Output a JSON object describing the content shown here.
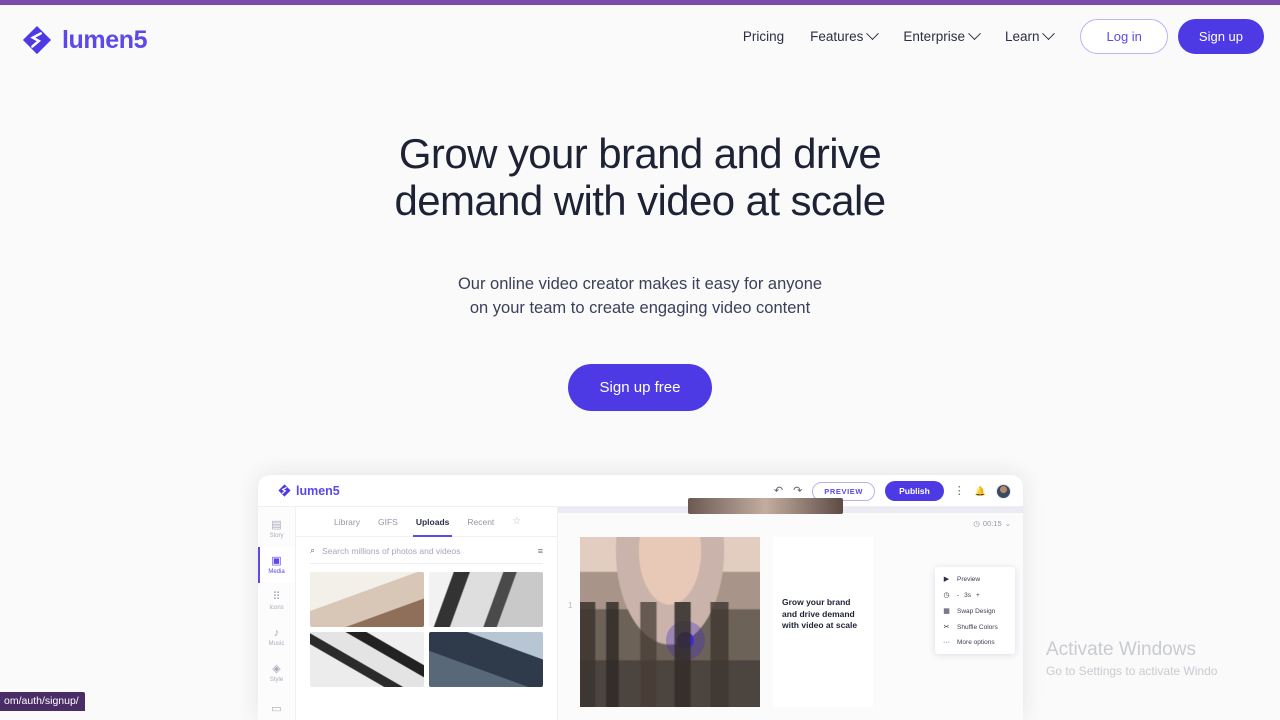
{
  "browser": {
    "top_bar_color": "#7a4bab",
    "status_url": "om/auth/signup/"
  },
  "header": {
    "brand": "lumen5",
    "brand_color": "#5b4ae8",
    "nav": [
      {
        "label": "Pricing",
        "has_chevron": false
      },
      {
        "label": "Features",
        "has_chevron": true
      },
      {
        "label": "Enterprise",
        "has_chevron": true
      },
      {
        "label": "Learn",
        "has_chevron": true
      }
    ],
    "login_label": "Log in",
    "signup_label": "Sign up"
  },
  "hero": {
    "title_line1": "Grow your brand and drive",
    "title_line2": "demand with video at scale",
    "subtitle_line1": "Our online video creator makes it easy for anyone",
    "subtitle_line2": "on your team to create engaging video content",
    "cta_label": "Sign up free",
    "cta_color": "#4e3ae4"
  },
  "mockup": {
    "brand": "lumen5",
    "topbar": {
      "undo_icon": "↶",
      "redo_icon": "↷",
      "preview_label": "PREVIEW",
      "publish_label": "Publish",
      "kebab_icon": "⋮",
      "bell_icon": "🔔"
    },
    "sidebar": [
      {
        "label": "Story",
        "glyph": "▤",
        "active": false
      },
      {
        "label": "Media",
        "glyph": "▣",
        "active": true
      },
      {
        "label": "Icons",
        "glyph": "⠿",
        "active": false
      },
      {
        "label": "Music",
        "glyph": "♪",
        "active": false
      },
      {
        "label": "Style",
        "glyph": "◈",
        "active": false
      },
      {
        "label": "",
        "glyph": "▭",
        "active": false
      }
    ],
    "media_tabs": [
      {
        "label": "Library",
        "active": false
      },
      {
        "label": "GIFS",
        "active": false
      },
      {
        "label": "Uploads",
        "active": true
      },
      {
        "label": "Recent",
        "active": false
      }
    ],
    "star_icon": "☆",
    "search_placeholder": "Search millions of photos and videos",
    "search_icon": "⌕",
    "filter_icon": "≡",
    "canvas": {
      "timer": "00:15",
      "timer_icon": "◷",
      "timer_caret": "⌄",
      "slide_number": "1",
      "card_text": "Grow your brand and drive demand with video at scale"
    },
    "context_menu": [
      {
        "glyph": "▶",
        "label": "Preview"
      },
      {
        "glyph": "◷",
        "label": "3s",
        "stepper": true,
        "minus": "-",
        "plus": "+"
      },
      {
        "glyph": "▦",
        "label": "Swap Design"
      },
      {
        "glyph": "✂",
        "label": "Shuffle Colors"
      },
      {
        "glyph": "···",
        "label": "More options"
      }
    ]
  },
  "watermark": {
    "line1": "Activate Windows",
    "line2": "Go to Settings to activate Windo"
  }
}
